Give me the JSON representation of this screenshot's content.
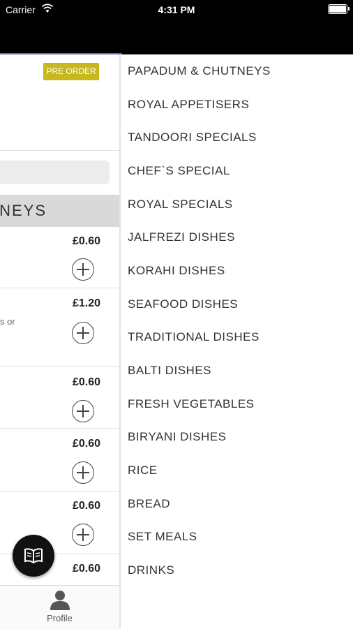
{
  "status_bar": {
    "carrier": "Carrier",
    "time": "4:31 PM"
  },
  "left_panel": {
    "pre_order_badge": "PRE ORDER",
    "category_header": "NEYS",
    "items": [
      {
        "price": "£0.60",
        "desc": ""
      },
      {
        "price": "£1.20",
        "desc": "s or"
      },
      {
        "price": "£0.60",
        "desc": ""
      },
      {
        "price": "£0.60",
        "desc": ""
      },
      {
        "price": "£0.60",
        "desc": ""
      },
      {
        "price": "£0.60",
        "desc": ""
      }
    ]
  },
  "tab_bar": {
    "profile_label": "Profile"
  },
  "drawer": {
    "items": [
      "PAPADUM & CHUTNEYS",
      "ROYAL APPETISERS",
      "TANDOORI SPECIALS",
      "CHEF`S SPECIAL",
      "ROYAL SPECIALS",
      "JALFREZI DISHES",
      "KORAHI DISHES",
      "SEAFOOD DISHES",
      "TRADITIONAL DISHES",
      "BALTI DISHES",
      "FRESH VEGETABLES",
      "BIRYANI DISHES",
      "RICE",
      "BREAD",
      "SET MEALS",
      "DRINKS"
    ]
  },
  "colors": {
    "badge": "#c7b81e",
    "status_bar": "#000000",
    "header_line": "#6a5acd"
  }
}
